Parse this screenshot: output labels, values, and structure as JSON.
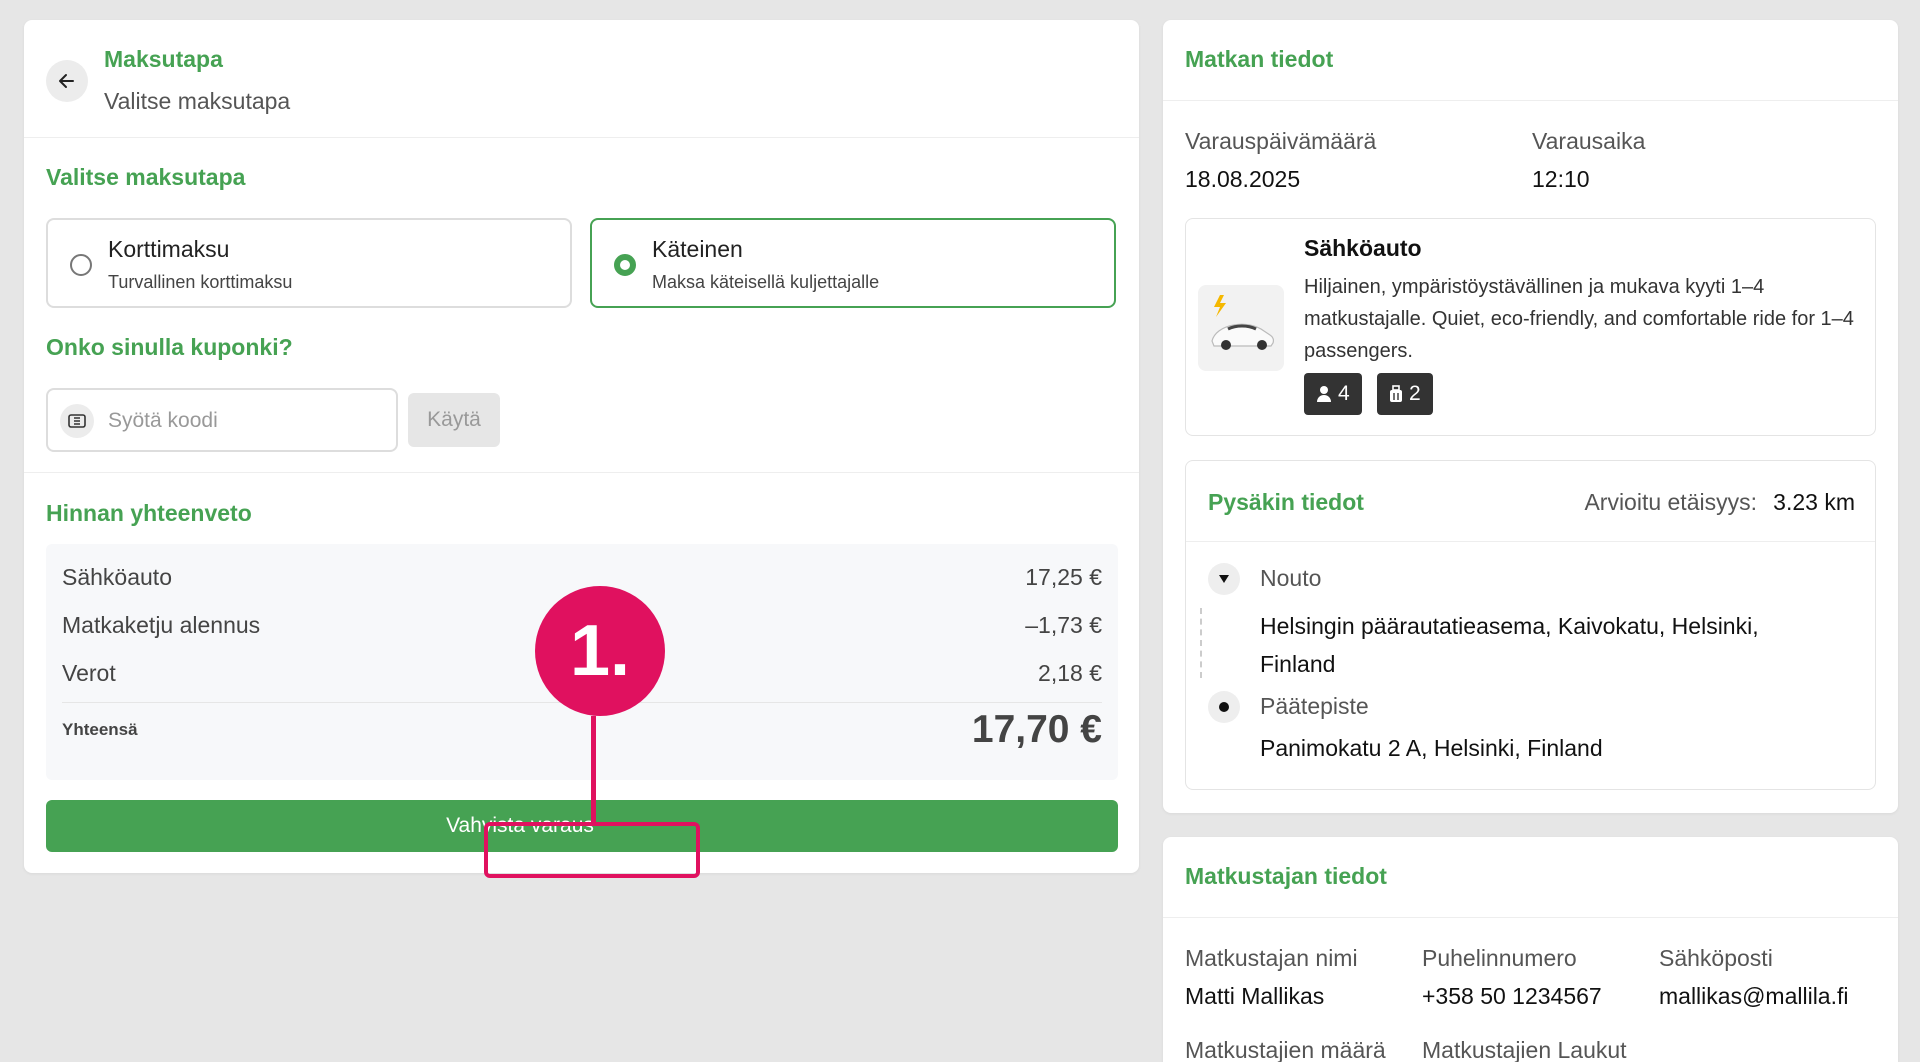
{
  "payment": {
    "header_title": "Maksutapa",
    "header_subtitle": "Valitse maksutapa",
    "section_title": "Valitse maksutapa",
    "options": [
      {
        "label": "Korttimaksu",
        "desc": "Turvallinen korttimaksu",
        "selected": false
      },
      {
        "label": "Käteinen",
        "desc": "Maksa käteisellä kuljettajalle",
        "selected": true
      }
    ],
    "coupon_title": "Onko sinulla kuponki?",
    "coupon_placeholder": "Syötä koodi",
    "coupon_apply": "Käytä"
  },
  "summary": {
    "title": "Hinnan yhteenveto",
    "rows": [
      {
        "label": "Sähköauto",
        "value": "17,25 €"
      },
      {
        "label": "Matkaketju alennus",
        "value": "–1,73 €"
      },
      {
        "label": "Verot",
        "value": "2,18 €"
      }
    ],
    "total_label": "Yhteensä",
    "total_value": "17,70 €",
    "confirm_label": "Vahvista varaus"
  },
  "annotation": {
    "marker": "1."
  },
  "trip": {
    "title": "Matkan tiedot",
    "date_label": "Varauspäivämäärä",
    "date_value": "18.08.2025",
    "time_label": "Varausaika",
    "time_value": "12:10",
    "vehicle": {
      "name": "Sähköauto",
      "description": "Hiljainen, ympäristöystävällinen ja mukava kyyti 1–4 matkustajalle. Quiet, eco-friendly, and comfortable ride for 1–4 passengers.",
      "passengers": "4",
      "luggage": "2"
    },
    "stops": {
      "title": "Pysäkin tiedot",
      "distance_label": "Arvioitu etäisyys:",
      "distance_value": "3.23 km",
      "pickup_label": "Nouto",
      "pickup_address": "Helsingin päärautatieasema, Kaivokatu, Helsinki, Finland",
      "dropoff_label": "Päätepiste",
      "dropoff_address": "Panimokatu 2 A, Helsinki, Finland"
    }
  },
  "traveler": {
    "title": "Matkustajan tiedot",
    "name_label": "Matkustajan nimi",
    "name_value": "Matti Mallikas",
    "phone_label": "Puhelinnumero",
    "phone_value": "+358 50 1234567",
    "email_label": "Sähköposti",
    "email_value": "mallikas@mallila.fi",
    "count_label": "Matkustajien määrä",
    "bags_label": "Matkustajien Laukut"
  },
  "colors": {
    "accent": "#46a253",
    "annotation": "#e0115f"
  }
}
